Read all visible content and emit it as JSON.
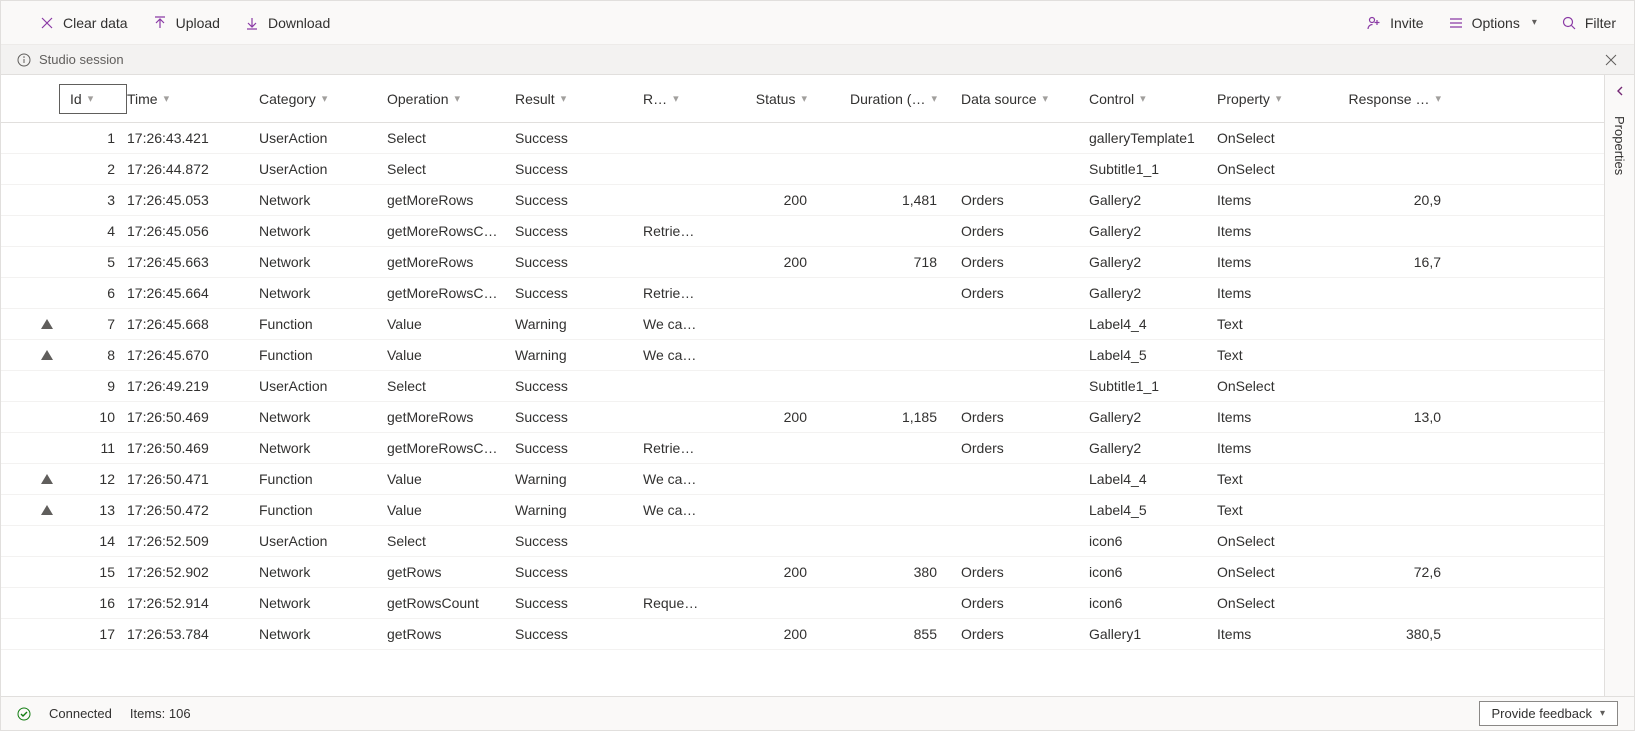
{
  "toolbar": {
    "clear": "Clear data",
    "upload": "Upload",
    "download": "Download",
    "invite": "Invite",
    "options": "Options",
    "filter": "Filter"
  },
  "sessionbar": {
    "label": "Studio session"
  },
  "rightrail": {
    "label": "Properties"
  },
  "footer": {
    "status": "Connected",
    "items_label": "Items:",
    "items_count": "106",
    "feedback": "Provide feedback"
  },
  "columns": {
    "id": "Id",
    "time": "Time",
    "category": "Category",
    "operation": "Operation",
    "result": "Result",
    "r": "R…",
    "status": "Status",
    "duration": "Duration (…",
    "datasource": "Data source",
    "control": "Control",
    "property": "Property",
    "response": "Response …"
  },
  "rows": [
    {
      "warn": false,
      "id": "1",
      "time": "17:26:43.421",
      "category": "UserAction",
      "operation": "Select",
      "result": "Success",
      "r": "",
      "status": "",
      "duration": "",
      "datasource": "",
      "control": "galleryTemplate1",
      "property": "OnSelect",
      "response": ""
    },
    {
      "warn": false,
      "id": "2",
      "time": "17:26:44.872",
      "category": "UserAction",
      "operation": "Select",
      "result": "Success",
      "r": "",
      "status": "",
      "duration": "",
      "datasource": "",
      "control": "Subtitle1_1",
      "property": "OnSelect",
      "response": ""
    },
    {
      "warn": false,
      "id": "3",
      "time": "17:26:45.053",
      "category": "Network",
      "operation": "getMoreRows",
      "result": "Success",
      "r": "",
      "status": "200",
      "duration": "1,481",
      "datasource": "Orders",
      "control": "Gallery2",
      "property": "Items",
      "response": "20,9"
    },
    {
      "warn": false,
      "id": "4",
      "time": "17:26:45.056",
      "category": "Network",
      "operation": "getMoreRowsC…",
      "result": "Success",
      "r": "Retrie…",
      "status": "",
      "duration": "",
      "datasource": "Orders",
      "control": "Gallery2",
      "property": "Items",
      "response": ""
    },
    {
      "warn": false,
      "id": "5",
      "time": "17:26:45.663",
      "category": "Network",
      "operation": "getMoreRows",
      "result": "Success",
      "r": "",
      "status": "200",
      "duration": "718",
      "datasource": "Orders",
      "control": "Gallery2",
      "property": "Items",
      "response": "16,7"
    },
    {
      "warn": false,
      "id": "6",
      "time": "17:26:45.664",
      "category": "Network",
      "operation": "getMoreRowsC…",
      "result": "Success",
      "r": "Retrie…",
      "status": "",
      "duration": "",
      "datasource": "Orders",
      "control": "Gallery2",
      "property": "Items",
      "response": ""
    },
    {
      "warn": true,
      "id": "7",
      "time": "17:26:45.668",
      "category": "Function",
      "operation": "Value",
      "result": "Warning",
      "r": "We ca…",
      "status": "",
      "duration": "",
      "datasource": "",
      "control": "Label4_4",
      "property": "Text",
      "response": ""
    },
    {
      "warn": true,
      "id": "8",
      "time": "17:26:45.670",
      "category": "Function",
      "operation": "Value",
      "result": "Warning",
      "r": "We ca…",
      "status": "",
      "duration": "",
      "datasource": "",
      "control": "Label4_5",
      "property": "Text",
      "response": ""
    },
    {
      "warn": false,
      "id": "9",
      "time": "17:26:49.219",
      "category": "UserAction",
      "operation": "Select",
      "result": "Success",
      "r": "",
      "status": "",
      "duration": "",
      "datasource": "",
      "control": "Subtitle1_1",
      "property": "OnSelect",
      "response": ""
    },
    {
      "warn": false,
      "id": "10",
      "time": "17:26:50.469",
      "category": "Network",
      "operation": "getMoreRows",
      "result": "Success",
      "r": "",
      "status": "200",
      "duration": "1,185",
      "datasource": "Orders",
      "control": "Gallery2",
      "property": "Items",
      "response": "13,0"
    },
    {
      "warn": false,
      "id": "11",
      "time": "17:26:50.469",
      "category": "Network",
      "operation": "getMoreRowsC…",
      "result": "Success",
      "r": "Retrie…",
      "status": "",
      "duration": "",
      "datasource": "Orders",
      "control": "Gallery2",
      "property": "Items",
      "response": ""
    },
    {
      "warn": true,
      "id": "12",
      "time": "17:26:50.471",
      "category": "Function",
      "operation": "Value",
      "result": "Warning",
      "r": "We ca…",
      "status": "",
      "duration": "",
      "datasource": "",
      "control": "Label4_4",
      "property": "Text",
      "response": ""
    },
    {
      "warn": true,
      "id": "13",
      "time": "17:26:50.472",
      "category": "Function",
      "operation": "Value",
      "result": "Warning",
      "r": "We ca…",
      "status": "",
      "duration": "",
      "datasource": "",
      "control": "Label4_5",
      "property": "Text",
      "response": ""
    },
    {
      "warn": false,
      "id": "14",
      "time": "17:26:52.509",
      "category": "UserAction",
      "operation": "Select",
      "result": "Success",
      "r": "",
      "status": "",
      "duration": "",
      "datasource": "",
      "control": "icon6",
      "property": "OnSelect",
      "response": ""
    },
    {
      "warn": false,
      "id": "15",
      "time": "17:26:52.902",
      "category": "Network",
      "operation": "getRows",
      "result": "Success",
      "r": "",
      "status": "200",
      "duration": "380",
      "datasource": "Orders",
      "control": "icon6",
      "property": "OnSelect",
      "response": "72,6"
    },
    {
      "warn": false,
      "id": "16",
      "time": "17:26:52.914",
      "category": "Network",
      "operation": "getRowsCount",
      "result": "Success",
      "r": "Reque…",
      "status": "",
      "duration": "",
      "datasource": "Orders",
      "control": "icon6",
      "property": "OnSelect",
      "response": ""
    },
    {
      "warn": false,
      "id": "17",
      "time": "17:26:53.784",
      "category": "Network",
      "operation": "getRows",
      "result": "Success",
      "r": "",
      "status": "200",
      "duration": "855",
      "datasource": "Orders",
      "control": "Gallery1",
      "property": "Items",
      "response": "380,5"
    }
  ]
}
